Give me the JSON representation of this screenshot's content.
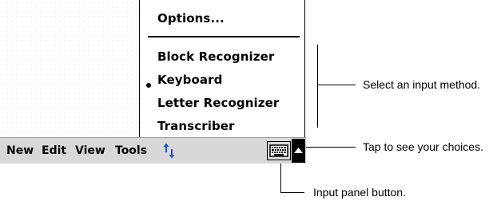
{
  "popup_menu": {
    "options_label": "Options...",
    "items": [
      {
        "label": "Block Recognizer",
        "selected": false
      },
      {
        "label": "Keyboard",
        "selected": true
      },
      {
        "label": "Letter Recognizer",
        "selected": false
      },
      {
        "label": "Transcriber",
        "selected": false
      }
    ]
  },
  "menubar": {
    "items": [
      "New",
      "Edit",
      "View",
      "Tools"
    ]
  },
  "callouts": {
    "input_method": "Select an input method.",
    "choices": "Tap to see your choices.",
    "panel_button": "Input panel button."
  },
  "icons": {
    "updown": "up-down-arrows-icon",
    "keyboard": "keyboard-icon",
    "menu_arrow": "triangle-up-icon"
  }
}
